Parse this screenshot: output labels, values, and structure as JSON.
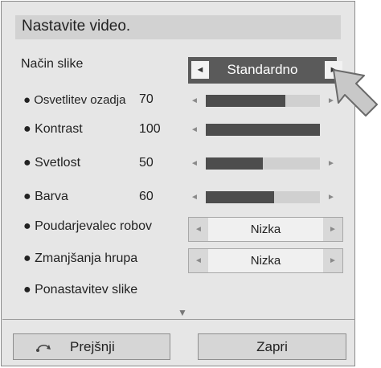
{
  "title": "Nastavite video.",
  "mode": {
    "label": "Način slike",
    "value": "Standardno",
    "left_icon": "triangle-left-icon",
    "right_icon": "triangle-right-icon"
  },
  "sliders": [
    {
      "label": "● Osvetlitev ozadja",
      "value": "70",
      "level": 0.7
    },
    {
      "label": "● Kontrast",
      "value": "100",
      "level": 1.0
    },
    {
      "label": "● Svetlost",
      "value": "50",
      "level": 0.5
    },
    {
      "label": "● Barva",
      "value": "60",
      "level": 0.6
    }
  ],
  "selectors": [
    {
      "label": "● Poudarjevalec robov",
      "value": "Nizka"
    },
    {
      "label": "● Zmanjšanja hrupa",
      "value": "Nizka"
    }
  ],
  "reset": {
    "label": "● Ponastavitev slike"
  },
  "buttons": {
    "back": "Prejšnji",
    "close": "Zapri"
  },
  "icons": {
    "back": "return-arrow-icon",
    "cursor": "pointer-arrow-icon",
    "scroll": "scroll-down-icon"
  },
  "colors": {
    "panel": "#e6e6e6",
    "selected": "#5a5a5a",
    "fill": "#4d4d4d",
    "track": "#d0d0d0"
  }
}
